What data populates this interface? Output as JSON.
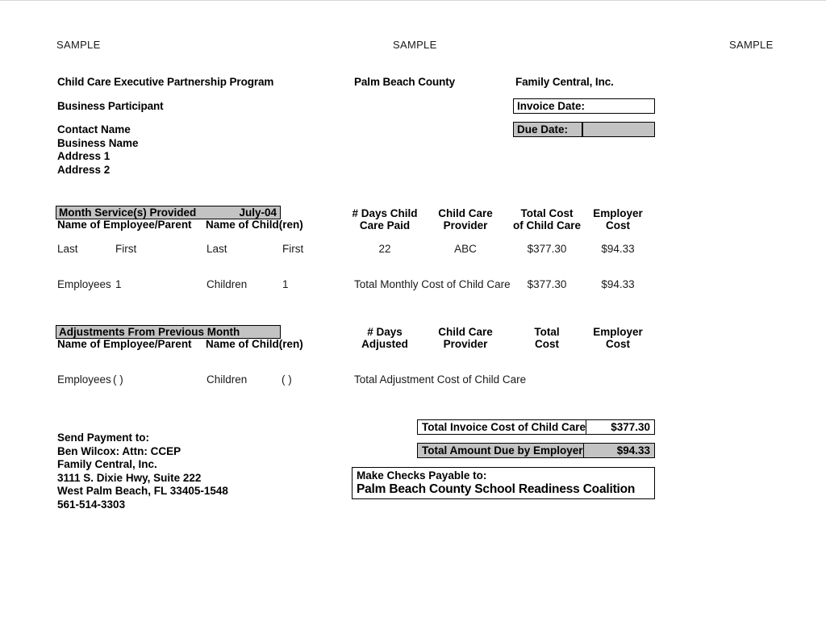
{
  "watermarks": [
    {
      "text": "SAMPLE"
    },
    {
      "text": "SAMPLE"
    },
    {
      "text": "SAMPLE"
    }
  ],
  "header": {
    "program_title": "Child Care Executive Partnership Program",
    "participant_label": "Business Participant",
    "county": "Palm Beach County",
    "company": "Family Central, Inc.",
    "contact_block": [
      "Contact Name",
      "Business Name",
      "Address 1",
      "Address 2"
    ],
    "invoice_date": {
      "label": "Invoice Date:",
      "value": ""
    },
    "due_date": {
      "label": "Due Date:",
      "value": ""
    }
  },
  "service_section": {
    "bar_title": "Month Service(s) Provided",
    "bar_month": "July-04",
    "col_employee": "Name of Employee/Parent",
    "col_child": "Name of Child(ren)",
    "col_days": "# Days Child\nCare Paid",
    "col_days_line1": "# Days Child",
    "col_days_line2": "Care Paid",
    "col_provider_line1": "Child Care",
    "col_provider_line2": "Provider",
    "col_totalcost_line1": "Total Cost",
    "col_totalcost_line2": "of Child Care",
    "col_employer_line1": "Employer",
    "col_employer_line2": "Cost",
    "rows": [
      {
        "employee_last": "Last",
        "employee_first": "First",
        "child_last": "Last",
        "child_first": "First",
        "days": "22",
        "provider": "ABC",
        "total_cost": "$377.30",
        "employer_cost": "$94.33"
      }
    ],
    "summary": {
      "employees_label": "Employees",
      "employees_count": "1",
      "children_label": "Children",
      "children_count": "1",
      "total_label": "Total Monthly Cost of Child Care",
      "total_cost": "$377.30",
      "employer_cost": "$94.33"
    }
  },
  "adjustments_section": {
    "bar_title": "Adjustments From Previous Month",
    "col_employee": "Name of Employee/Parent",
    "col_child": "Name of Child(ren)",
    "col_days_line1": "# Days",
    "col_days_line2": "Adjusted",
    "col_provider_line1": "Child Care",
    "col_provider_line2": "Provider",
    "col_totalcost_line1": "Total",
    "col_totalcost_line2": "Cost",
    "col_employer_line1": "Employer",
    "col_employer_line2": "Cost",
    "summary": {
      "employees_label": "Employees",
      "employees_count": "( )",
      "children_label": "Children",
      "children_count": "( )",
      "total_label": "Total Adjustment Cost of Child Care"
    }
  },
  "totals": {
    "invoice_total": {
      "label": "Total Invoice Cost of Child Care",
      "value": "$377.30"
    },
    "amount_due": {
      "label": "Total Amount Due by Employer",
      "value": "$94.33"
    }
  },
  "payment": {
    "send_payment_lines": [
      "Send Payment to:",
      "Ben Wilcox: Attn: CCEP",
      "Family Central, Inc.",
      "3111 S. Dixie Hwy, Suite 222",
      "West Palm Beach, FL 33405-1548",
      "561-514-3303"
    ],
    "checks_payable_label": "Make Checks Payable to:",
    "checks_payable_to": "Palm Beach County School Readiness Coalition"
  },
  "colors": {
    "shade": "#c3c3c3",
    "border": "#000000",
    "text": "#000000"
  }
}
